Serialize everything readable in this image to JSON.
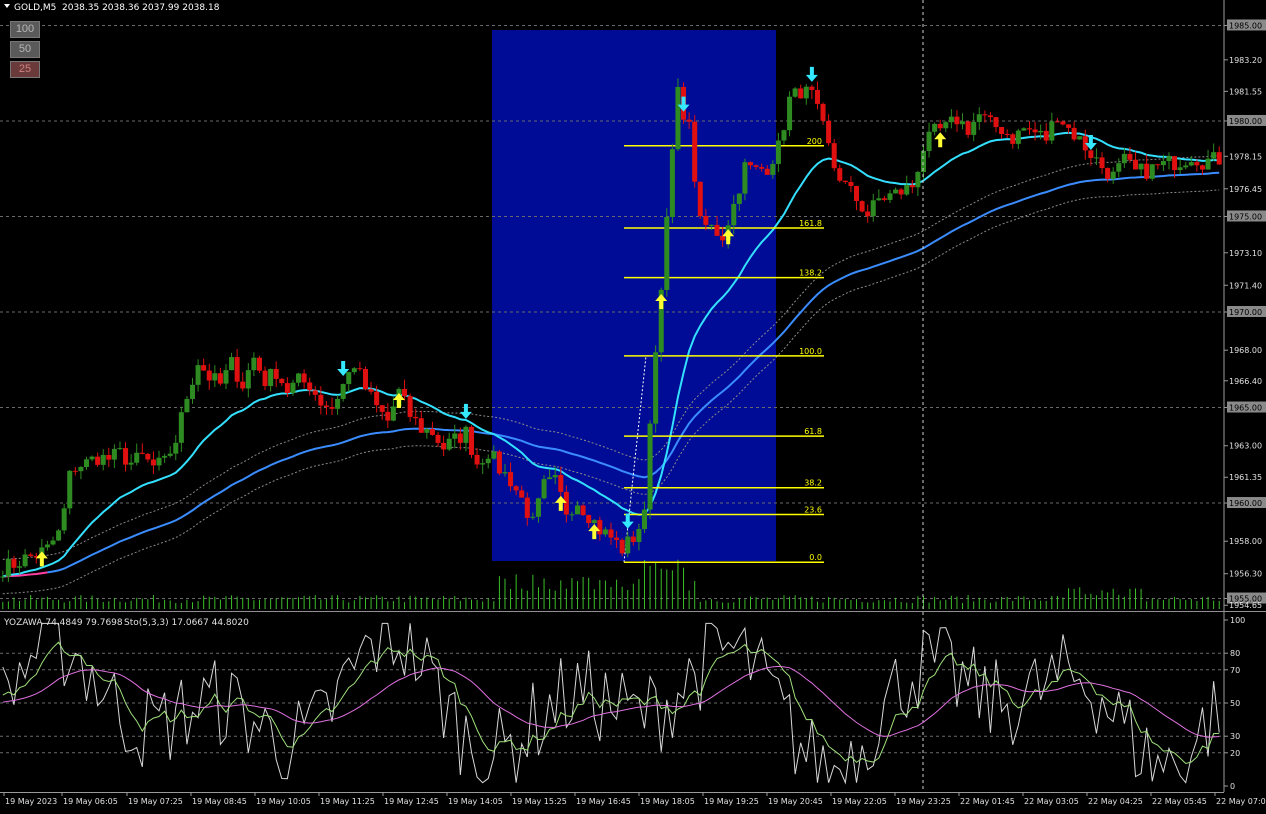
{
  "header": {
    "symbol": "GOLD,M5",
    "quote": "2038.35 2038.36 2037.99 2038.18"
  },
  "zoom_buttons": [
    "100",
    "50",
    "25"
  ],
  "indicator": {
    "title": "YOZAWA 74.4849 79.7698",
    "sto_title": "Sto(5,3,3) 17.0667 44.8020",
    "levels": [
      "100",
      "80",
      "70",
      "50",
      "30",
      "20",
      "0"
    ]
  },
  "colors": {
    "background": "#000000",
    "bull": "#2e8b22",
    "bear": "#e01010",
    "zone": "#000c96",
    "fib": "#ffff00",
    "ma_fast": "#33e0ff",
    "ma_slow": "#3a8cff",
    "ma_pink": "#ff40a0",
    "up_arrow": "#ffff33",
    "down_arrow": "#33e8ff",
    "volume": "#3cbf2a"
  },
  "chart_data": {
    "type": "candlestick",
    "y_axis": {
      "ticks": [
        "1985.00",
        "1983.20",
        "1981.55",
        "1980.00",
        "1978.15",
        "1976.45",
        "1975.00",
        "1973.10",
        "1971.40",
        "1970.00",
        "1968.00",
        "1966.40",
        "1965.00",
        "1963.00",
        "1961.35",
        "1960.00",
        "1958.00",
        "1956.30",
        "1955.00",
        "1954.65"
      ],
      "highlighted": [
        "1985.00",
        "1980.00",
        "1975.00",
        "1970.00",
        "1965.00",
        "1960.00",
        "1955.00"
      ],
      "range": [
        1954.4,
        1985.6
      ]
    },
    "x_axis": {
      "ticks": [
        "19 May 2023",
        "19 May 06:05",
        "19 May 07:25",
        "19 May 08:45",
        "19 May 10:05",
        "19 May 11:25",
        "19 May 12:45",
        "19 May 14:05",
        "19 May 15:25",
        "19 May 16:45",
        "19 May 18:05",
        "19 May 19:25",
        "19 May 20:45",
        "19 May 22:05",
        "19 May 23:25",
        "22 May 01:45",
        "22 May 03:05",
        "22 May 04:25",
        "22 May 05:45",
        "22 May 07:05"
      ]
    },
    "fibonacci": {
      "levels": [
        {
          "label": "200",
          "price": 1978.7
        },
        {
          "label": "161.8",
          "price": 1974.4
        },
        {
          "label": "138.2",
          "price": 1971.8
        },
        {
          "label": "100.0",
          "price": 1967.7
        },
        {
          "label": "61.8",
          "price": 1963.5
        },
        {
          "label": "38.2",
          "price": 1960.8
        },
        {
          "label": "23.6",
          "price": 1959.4
        },
        {
          "label": "0.0",
          "price": 1956.9
        }
      ]
    },
    "close_path": [
      [
        0,
        1956.6
      ],
      [
        2,
        1956.8
      ],
      [
        4,
        1957.1
      ],
      [
        6,
        1957.3
      ],
      [
        8,
        1957.6
      ],
      [
        10,
        1958.4
      ],
      [
        11,
        1959.6
      ],
      [
        12,
        1961.4
      ],
      [
        13,
        1961.9
      ],
      [
        15,
        1962.1
      ],
      [
        17,
        1962.4
      ],
      [
        19,
        1962.3
      ],
      [
        21,
        1962.6
      ],
      [
        23,
        1962.1
      ],
      [
        25,
        1962.4
      ],
      [
        27,
        1961.9
      ],
      [
        29,
        1962.1
      ],
      [
        31,
        1963.3
      ],
      [
        33,
        1965.6
      ],
      [
        35,
        1967.4
      ],
      [
        37,
        1966.6
      ],
      [
        39,
        1966.2
      ],
      [
        41,
        1967.3
      ],
      [
        43,
        1966.2
      ],
      [
        45,
        1967.6
      ],
      [
        47,
        1966.4
      ],
      [
        49,
        1966.9
      ],
      [
        51,
        1965.9
      ],
      [
        53,
        1966.4
      ],
      [
        55,
        1966.2
      ],
      [
        57,
        1965.3
      ],
      [
        59,
        1965.0
      ],
      [
        61,
        1966.2
      ],
      [
        63,
        1967.3
      ],
      [
        65,
        1966.0
      ],
      [
        67,
        1965.0
      ],
      [
        69,
        1964.3
      ],
      [
        71,
        1965.8
      ],
      [
        73,
        1964.6
      ],
      [
        75,
        1963.9
      ],
      [
        77,
        1963.7
      ],
      [
        79,
        1962.9
      ],
      [
        81,
        1963.3
      ],
      [
        83,
        1963.7
      ],
      [
        85,
        1962.1
      ],
      [
        87,
        1962.7
      ],
      [
        89,
        1961.8
      ],
      [
        91,
        1961.2
      ],
      [
        93,
        1960.2
      ],
      [
        95,
        1958.9
      ],
      [
        97,
        1960.9
      ],
      [
        99,
        1961.1
      ],
      [
        101,
        1959.6
      ],
      [
        103,
        1960.1
      ],
      [
        105,
        1959.4
      ],
      [
        107,
        1958.6
      ],
      [
        109,
        1958.2
      ],
      [
        111,
        1957.6
      ],
      [
        113,
        1958.2
      ],
      [
        115,
        1959.3
      ],
      [
        116,
        1964.5
      ],
      [
        117,
        1967.9
      ],
      [
        118,
        1971.6
      ],
      [
        119,
        1974.6
      ],
      [
        120,
        1978.4
      ],
      [
        121,
        1981.4
      ],
      [
        123,
        1979.6
      ],
      [
        125,
        1974.6
      ],
      [
        127,
        1974.4
      ],
      [
        129,
        1974.0
      ],
      [
        131,
        1975.6
      ],
      [
        133,
        1977.6
      ],
      [
        135,
        1977.4
      ],
      [
        137,
        1977.6
      ],
      [
        139,
        1978.6
      ],
      [
        141,
        1981.1
      ],
      [
        143,
        1981.6
      ],
      [
        145,
        1981.3
      ],
      [
        147,
        1979.6
      ],
      [
        149,
        1977.6
      ],
      [
        151,
        1976.6
      ],
      [
        153,
        1975.9
      ],
      [
        155,
        1975.1
      ],
      [
        157,
        1975.9
      ],
      [
        159,
        1976.1
      ],
      [
        161,
        1976.3
      ],
      [
        163,
        1976.6
      ],
      [
        165,
        1978.6
      ],
      [
        167,
        1979.4
      ],
      [
        169,
        1979.6
      ],
      [
        171,
        1980.1
      ],
      [
        173,
        1979.6
      ],
      [
        175,
        1980.3
      ],
      [
        177,
        1979.8
      ],
      [
        179,
        1979.6
      ],
      [
        181,
        1979.1
      ],
      [
        183,
        1979.6
      ],
      [
        185,
        1979.4
      ],
      [
        187,
        1979.1
      ],
      [
        189,
        1980.4
      ],
      [
        191,
        1979.6
      ],
      [
        193,
        1979.0
      ],
      [
        195,
        1978.3
      ],
      [
        197,
        1977.6
      ],
      [
        199,
        1977.1
      ],
      [
        201,
        1977.9
      ],
      [
        203,
        1977.3
      ],
      [
        205,
        1977.4
      ],
      [
        207,
        1977.6
      ],
      [
        209,
        1977.8
      ],
      [
        211,
        1977.9
      ],
      [
        213,
        1978.2
      ],
      [
        215,
        1977.9
      ],
      [
        218,
        1978.0
      ]
    ]
  }
}
